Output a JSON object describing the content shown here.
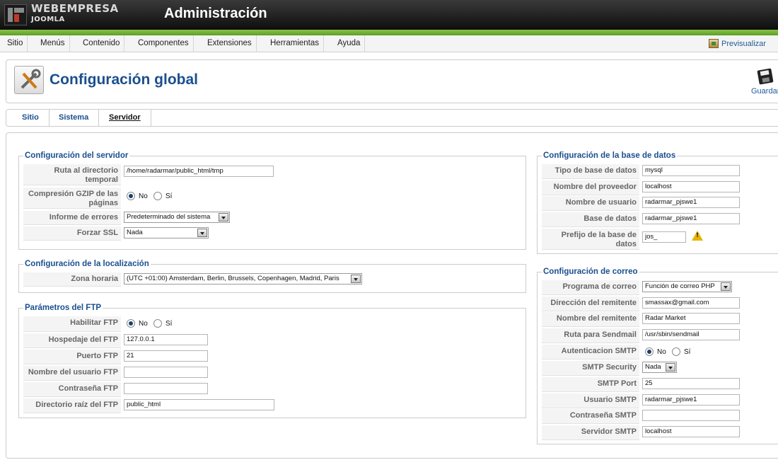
{
  "header": {
    "brand": "WEBEMPRESA",
    "brand_sub": "JOOMLA",
    "title": "Administración"
  },
  "menu": {
    "items": [
      "Sitio",
      "Menús",
      "Contenido",
      "Componentes",
      "Extensiones",
      "Herramientas",
      "Ayuda"
    ],
    "preview_label": "Previsualizar"
  },
  "toolbar": {
    "page_title": "Configuración global",
    "save_label": "Guardar"
  },
  "tabs": {
    "items": [
      "Sitio",
      "Sistema",
      "Servidor"
    ],
    "active": "Servidor"
  },
  "server": {
    "legend": "Configuración del servidor",
    "temp_path_label": "Ruta al directorio temporal",
    "temp_path_value": "/home/radarmar/public_html/tmp",
    "gzip_label": "Compresión GZIP de las páginas",
    "gzip_no": "No",
    "gzip_yes": "Sí",
    "gzip_selected": "No",
    "error_label": "Informe de errores",
    "error_value": "Predeterminado del sistema",
    "ssl_label": "Forzar SSL",
    "ssl_value": "Nada"
  },
  "locale": {
    "legend": "Configuración de la localización",
    "tz_label": "Zona horaria",
    "tz_value": "(UTC +01:00) Amsterdam, Berlin, Brussels, Copenhagen, Madrid, Paris"
  },
  "ftp": {
    "legend": "Parámetros del FTP",
    "enable_label": "Habilitar FTP",
    "enable_no": "No",
    "enable_yes": "Sí",
    "enable_selected": "No",
    "host_label": "Hospedaje del FTP",
    "host_value": "127.0.0.1",
    "port_label": "Puerto FTP",
    "port_value": "21",
    "user_label": "Nombre del usuario FTP",
    "user_value": "",
    "pass_label": "Contraseña FTP",
    "pass_value": "",
    "root_label": "Directorio raíz del FTP",
    "root_value": "public_html"
  },
  "database": {
    "legend": "Configuración de la base de datos",
    "type_label": "Tipo de base de datos",
    "type_value": "mysql",
    "host_label": "Nombre del proveedor",
    "host_value": "localhost",
    "user_label": "Nombre de usuario",
    "user_value": "radarmar_pjswe1",
    "db_label": "Base de datos",
    "db_value": "radarmar_pjswe1",
    "prefix_label": "Prefijo de la base de datos",
    "prefix_value": "jos_"
  },
  "mail": {
    "legend": "Configuración de correo",
    "mailer_label": "Programa de correo",
    "mailer_value": "Función de correo PHP",
    "from_label": "Dirección del remitente",
    "from_value": "smassax@gmail.com",
    "fromname_label": "Nombre del remitente",
    "fromname_value": "Radar Market",
    "sendmail_label": "Ruta para Sendmail",
    "sendmail_value": "/usr/sbin/sendmail",
    "smtpauth_label": "Autenticacion SMTP",
    "smtpauth_no": "No",
    "smtpauth_yes": "Sí",
    "smtpauth_selected": "No",
    "smtpsecure_label": "SMTP Security",
    "smtpsecure_value": "Nada",
    "smtpport_label": "SMTP Port",
    "smtpport_value": "25",
    "smtpuser_label": "Usuario SMTP",
    "smtpuser_value": "radarmar_pjswe1",
    "smtppass_label": "Contraseña SMTP",
    "smtppass_value": "",
    "smtphost_label": "Servidor SMTP",
    "smtphost_value": "localhost"
  },
  "colors": {
    "accent_green": "#6fb22f",
    "heading_blue": "#1b4f8e",
    "header_dark": "#1a1a1a"
  }
}
